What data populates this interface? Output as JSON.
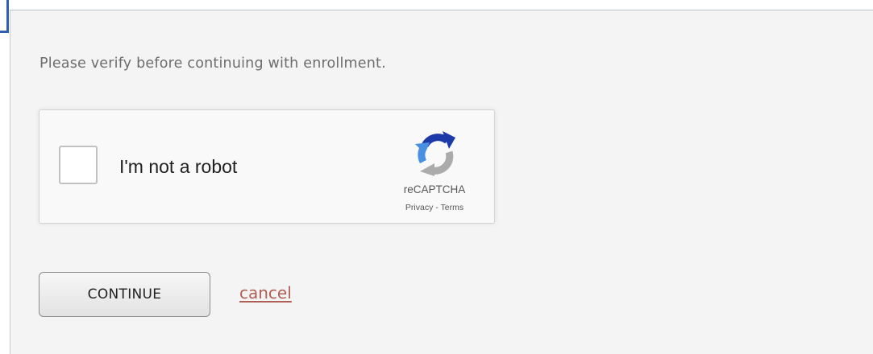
{
  "instruction": "Please verify before continuing with enrollment.",
  "recaptcha": {
    "checkbox_label": "I'm not a robot",
    "checked": false,
    "brand": "reCAPTCHA",
    "privacy_link": "Privacy",
    "separator": "-",
    "terms_link": "Terms",
    "logo_icon": "recaptcha-logo-icon"
  },
  "actions": {
    "continue_label": "CONTINUE",
    "cancel_label": "cancel"
  },
  "colors": {
    "accent_border": "#2f5fb4",
    "cancel_link": "#b05f55",
    "panel_background": "#f4f4f4"
  }
}
